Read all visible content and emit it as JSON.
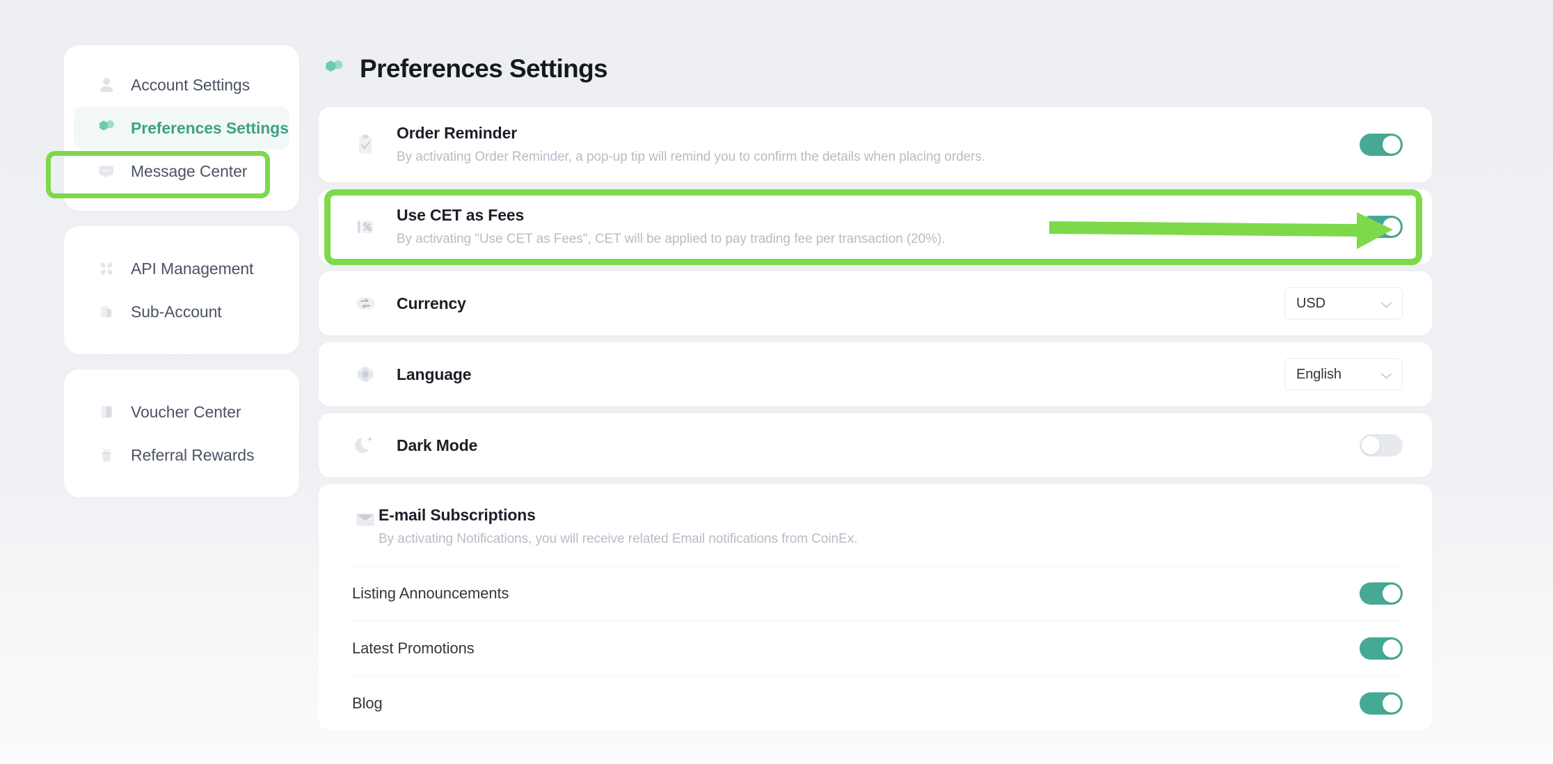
{
  "app": {
    "accent_teal": "#45a995",
    "accent_teal_text": "#3ea189",
    "annotation_green": "#7ed94a",
    "background": "#eef0f3"
  },
  "header": {
    "title": "Preferences Settings",
    "icon": "preferences-hexagons-icon"
  },
  "sidebar": {
    "groups": [
      {
        "items": [
          {
            "label": "Account Settings",
            "icon": "user-icon",
            "active": false
          },
          {
            "label": "Preferences Settings",
            "icon": "preferences-hexagons-icon",
            "active": true
          },
          {
            "label": "Message Center",
            "icon": "message-icon",
            "active": false
          }
        ]
      },
      {
        "items": [
          {
            "label": "API Management",
            "icon": "api-dots-icon",
            "active": false
          },
          {
            "label": "Sub-Account",
            "icon": "sub-account-icon",
            "active": false
          }
        ]
      },
      {
        "items": [
          {
            "label": "Voucher Center",
            "icon": "voucher-icon",
            "active": false
          },
          {
            "label": "Referral Rewards",
            "icon": "gift-bag-icon",
            "active": false
          }
        ]
      }
    ]
  },
  "settings": {
    "order_reminder": {
      "title": "Order Reminder",
      "description": "By activating Order Reminder, a pop-up tip will remind you to confirm the details when placing orders.",
      "icon": "clipboard-check-icon",
      "toggle": "on"
    },
    "use_cet_as_fees": {
      "title": "Use CET as Fees",
      "description": "By activating \"Use CET as Fees\", CET will be applied to pay trading fee per transaction (20%).",
      "icon": "percent-icon",
      "toggle": "on"
    },
    "currency": {
      "title": "Currency",
      "icon": "exchange-arrows-icon",
      "value": "USD"
    },
    "language": {
      "title": "Language",
      "icon": "globe-icon",
      "value": "English"
    },
    "dark_mode": {
      "title": "Dark Mode",
      "icon": "moon-star-icon",
      "toggle": "off"
    },
    "email_subscriptions": {
      "title": "E-mail Subscriptions",
      "description": "By activating Notifications, you will receive related Email notifications from CoinEx.",
      "icon": "envelope-icon",
      "items": [
        {
          "label": "Listing Announcements",
          "toggle": "on"
        },
        {
          "label": "Latest Promotions",
          "toggle": "on"
        },
        {
          "label": "Blog",
          "toggle": "on"
        }
      ]
    }
  },
  "annotations": {
    "highlight_sidebar_item": "Preferences Settings",
    "highlight_row": "Use CET as Fees",
    "arrow_points_to": "use-cet-as-fees-toggle"
  }
}
